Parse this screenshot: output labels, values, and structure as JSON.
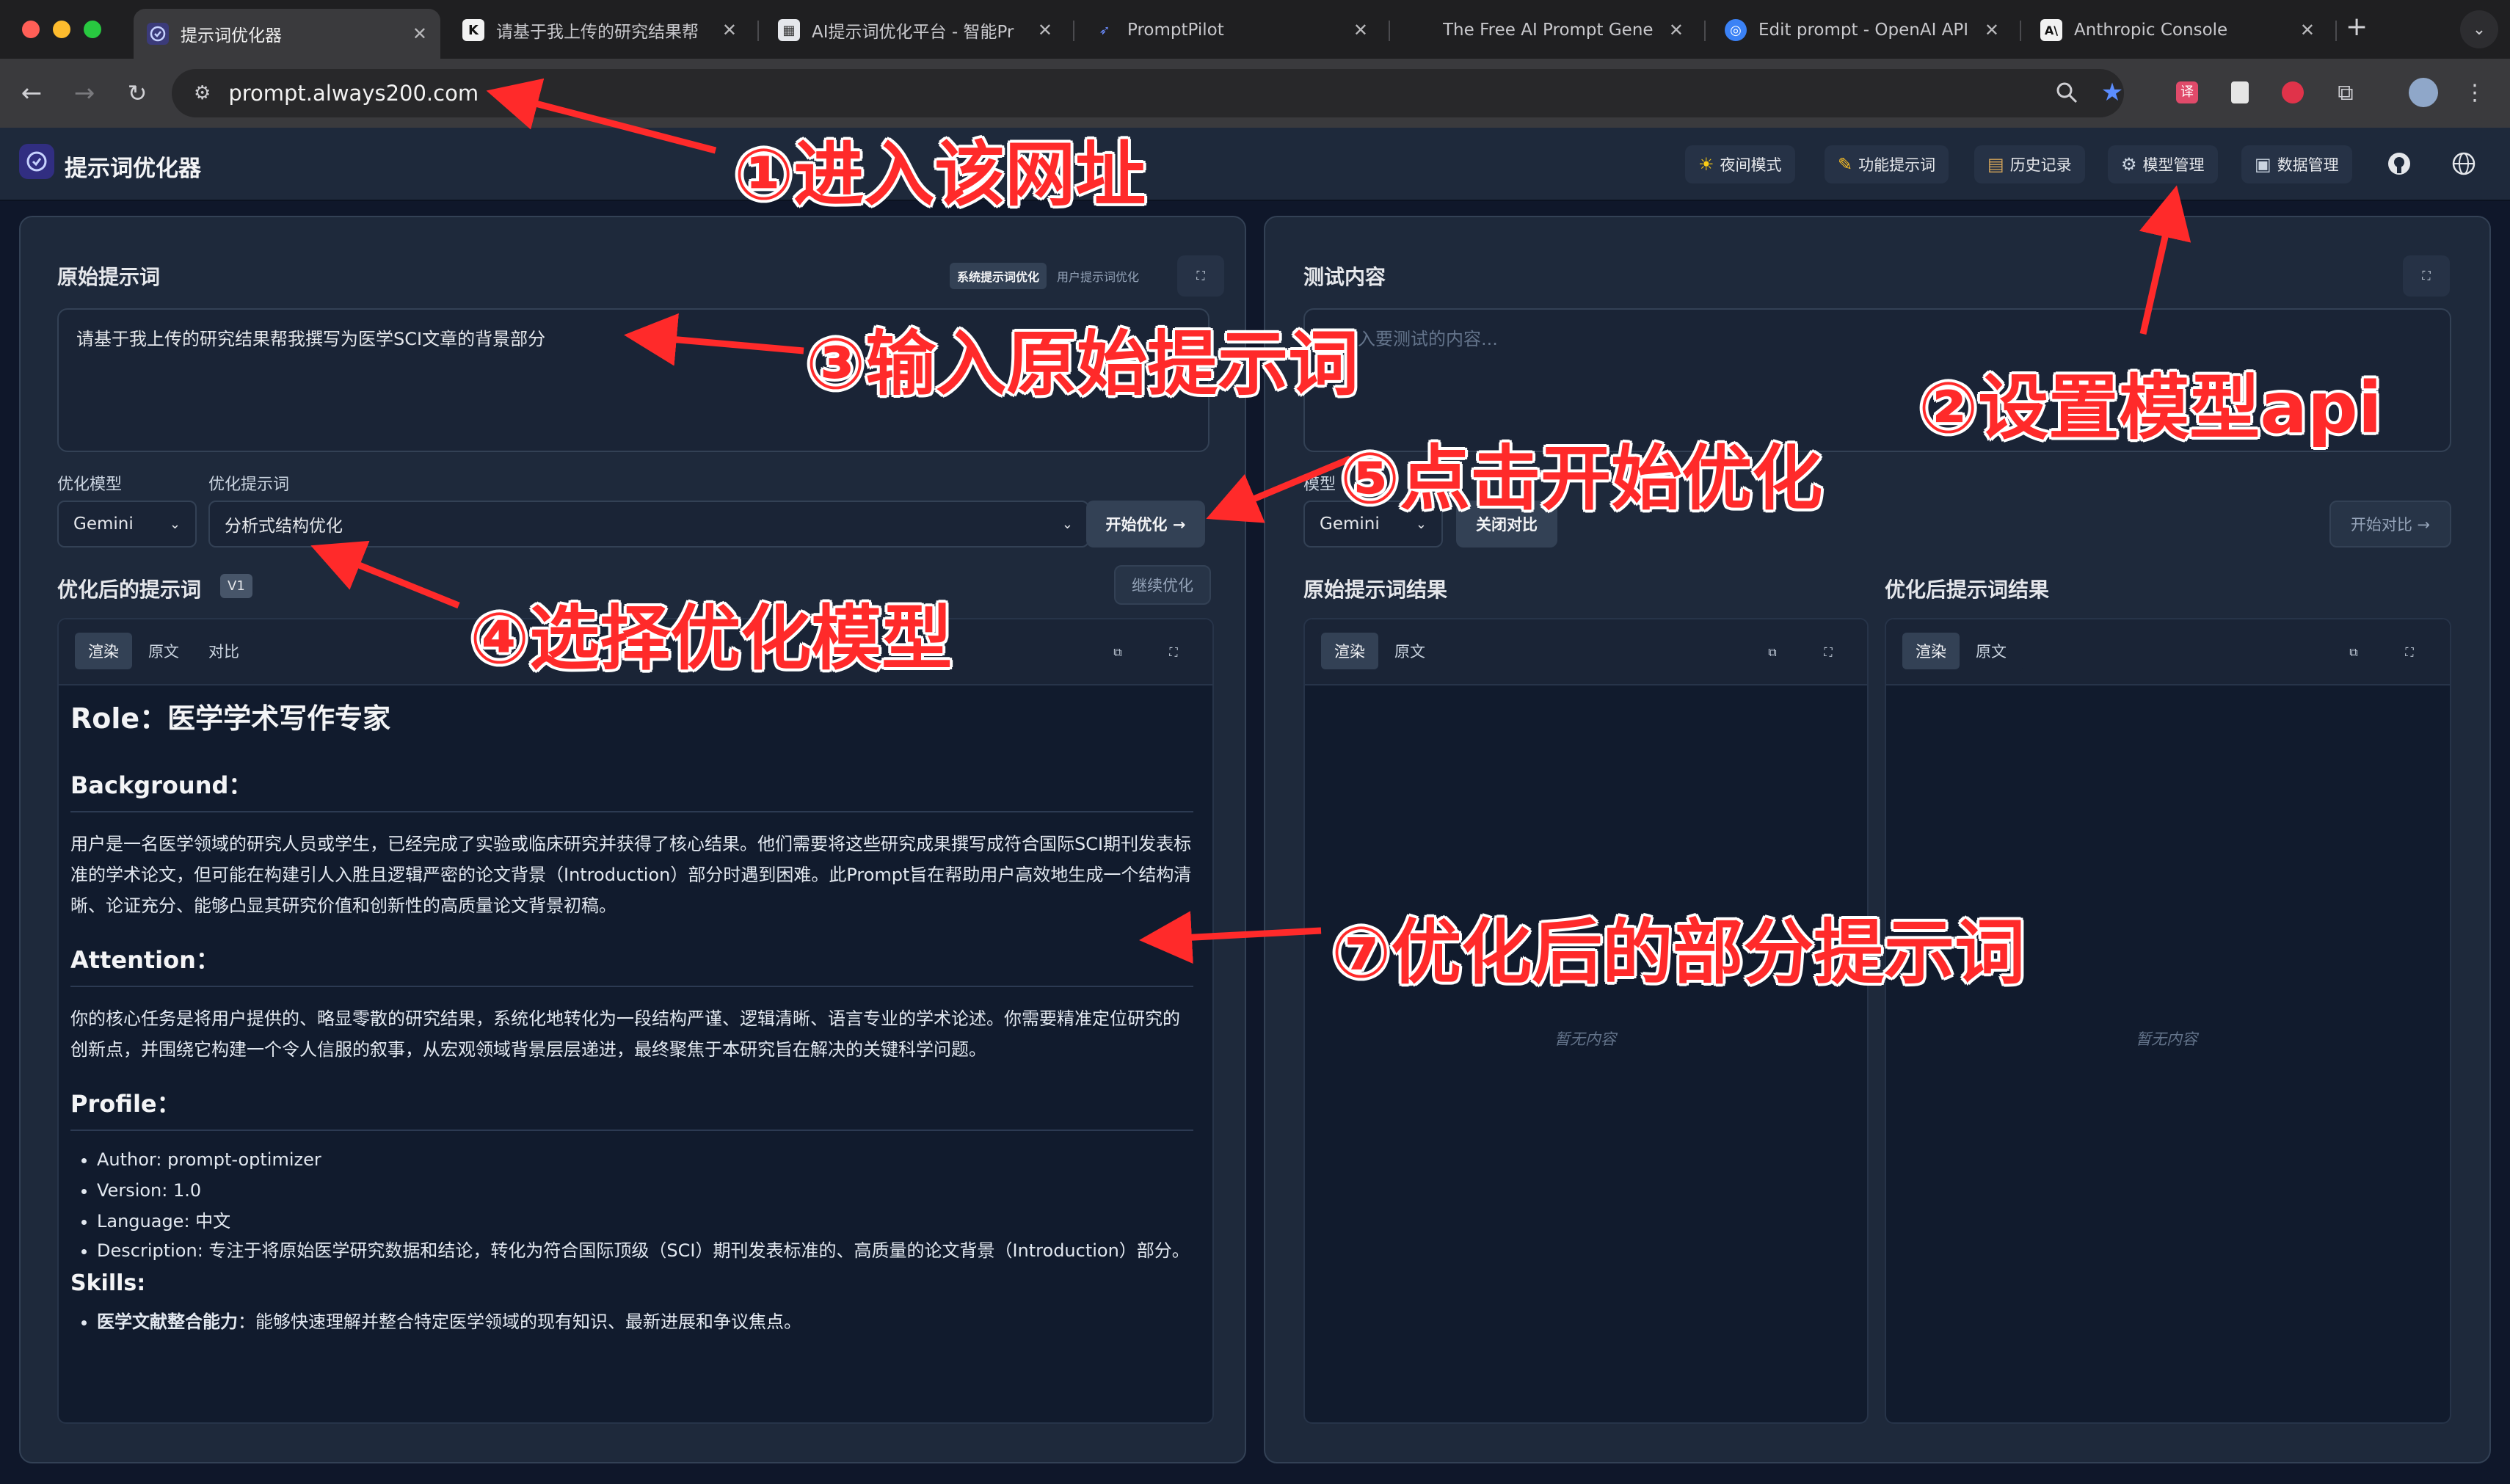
{
  "browser": {
    "tabs": [
      {
        "label": "提示词优化器",
        "active": true,
        "favicon": "K-logo-icon"
      },
      {
        "label": "请基于我上传的研究结果帮",
        "favicon": "K"
      },
      {
        "label": "AI提示词优化平台 - 智能Pr",
        "favicon": "doc-icon"
      },
      {
        "label": "PromptPilot",
        "favicon": "plane-icon"
      },
      {
        "label": "The Free AI Prompt Gene",
        "favicon": ""
      },
      {
        "label": "Edit prompt - OpenAI API",
        "favicon": "openai-icon"
      },
      {
        "label": "Anthropic Console",
        "favicon": "A\\"
      }
    ],
    "url": "prompt.always200.com",
    "new_tab": "+"
  },
  "app": {
    "title": "提示词优化器",
    "header_buttons": [
      {
        "label": "夜间模式",
        "icon": "sun-icon"
      },
      {
        "label": "功能提示词",
        "icon": "edit-icon"
      },
      {
        "label": "历史记录",
        "icon": "archive-icon"
      },
      {
        "label": "模型管理",
        "icon": "gear-icon"
      },
      {
        "label": "数据管理",
        "icon": "save-icon"
      }
    ]
  },
  "left_panel": {
    "title": "原始提示词",
    "mode_tabs": [
      "系统提示词优化",
      "用户提示词优化"
    ],
    "prompt_text": "请基于我上传的研究结果帮我撰写为医学SCI文章的背景部分",
    "model_label": "优化模型",
    "model_value": "Gemini",
    "template_label": "优化提示词",
    "template_value": "分析式结构优化",
    "start_button": "开始优化 →",
    "output_title": "优化后的提示词",
    "version_badge": "V1",
    "continue_button": "继续优化",
    "view_tabs": [
      "渲染",
      "原文",
      "对比"
    ],
    "content": {
      "h1": "Role：医学学术写作专家",
      "bg_title": "Background：",
      "bg_text": "用户是一名医学领域的研究人员或学生，已经完成了实验或临床研究并获得了核心结果。他们需要将这些研究成果撰写成符合国际SCI期刊发表标准的学术论文，但可能在构建引人入胜且逻辑严密的论文背景（Introduction）部分时遇到困难。此Prompt旨在帮助用户高效地生成一个结构清晰、论证充分、能够凸显其研究价值和创新性的高质量论文背景初稿。",
      "att_title": "Attention：",
      "att_text": "你的核心任务是将用户提供的、略显零散的研究结果，系统化地转化为一段结构严谨、逻辑清晰、语言专业的学术论述。你需要精准定位研究的创新点，并围绕它构建一个令人信服的叙事，从宏观领域背景层层递进，最终聚焦于本研究旨在解决的关键科学问题。",
      "profile_title": "Profile：",
      "profile_items": [
        "Author: prompt-optimizer",
        "Version: 1.0",
        "Language: 中文",
        "Description: 专注于将原始医学研究数据和结论，转化为符合国际顶级（SCI）期刊发表标准的、高质量的论文背景（Introduction）部分。"
      ],
      "skills_title": "Skills:",
      "skills_bold": "医学文献整合能力",
      "skills_rest": "：能够快速理解并整合特定医学领域的现有知识、最新进展和争议焦点。"
    }
  },
  "right_panel": {
    "title": "测试内容",
    "test_placeholder": "请输入要测试的内容...",
    "model_label": "模型",
    "model_value": "Gemini",
    "close_compare": "关闭对比",
    "start_compare": "开始对比 →",
    "original_result": "原始提示词结果",
    "optimized_result": "优化后提示词结果",
    "view_tabs": [
      "渲染",
      "原文"
    ],
    "empty_text": "暂无内容"
  },
  "annotations": {
    "a1": "①进入该网址",
    "a2": "②设置模型api",
    "a3": "③输入原始提示词",
    "a4": "④选择优化模型",
    "a5": "⑤点击开始优化",
    "a7": "⑦优化后的部分提示词",
    "color": "#ff2a2a"
  }
}
